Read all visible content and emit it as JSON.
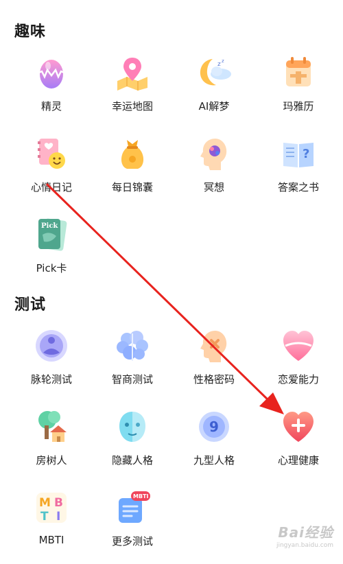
{
  "sections": {
    "fun": {
      "title": "趣味",
      "items": [
        {
          "label": "精灵",
          "icon": "elf-egg-icon"
        },
        {
          "label": "幸运地图",
          "icon": "lucky-map-icon"
        },
        {
          "label": "AI解梦",
          "icon": "ai-dream-moon-icon"
        },
        {
          "label": "玛雅历",
          "icon": "maya-calendar-icon"
        },
        {
          "label": "心情日记",
          "icon": "mood-diary-icon"
        },
        {
          "label": "每日锦囊",
          "icon": "daily-pouch-icon"
        },
        {
          "label": "冥想",
          "icon": "meditation-head-icon"
        },
        {
          "label": "答案之书",
          "icon": "answer-book-icon"
        },
        {
          "label": "Pick卡",
          "icon": "pick-card-icon"
        }
      ],
      "pick_card_text": "Pick"
    },
    "test": {
      "title": "测试",
      "items": [
        {
          "label": "脉轮测试",
          "icon": "chakra-test-icon"
        },
        {
          "label": "智商测试",
          "icon": "brain-iq-icon"
        },
        {
          "label": "性格密码",
          "icon": "personality-code-icon"
        },
        {
          "label": "恋爱能力",
          "icon": "love-heart-icon"
        },
        {
          "label": "房树人",
          "icon": "house-tree-person-icon"
        },
        {
          "label": "隐藏人格",
          "icon": "hidden-personality-icon"
        },
        {
          "label": "九型人格",
          "icon": "enneagram-icon"
        },
        {
          "label": "心理健康",
          "icon": "mental-health-heart-icon"
        },
        {
          "label": "MBTI",
          "icon": "mbti-icon"
        },
        {
          "label": "更多测试",
          "icon": "more-tests-icon"
        }
      ],
      "enneagram_digit": "9",
      "mbti_letters": [
        "M",
        "B",
        "T",
        "I"
      ],
      "more_badge": "MBTI"
    }
  },
  "annotation": {
    "color": "#e8231e",
    "icon": "red-arrow-annotation"
  },
  "watermark": {
    "main": "Bai经验",
    "sub": "jingyan.baidu.com"
  }
}
